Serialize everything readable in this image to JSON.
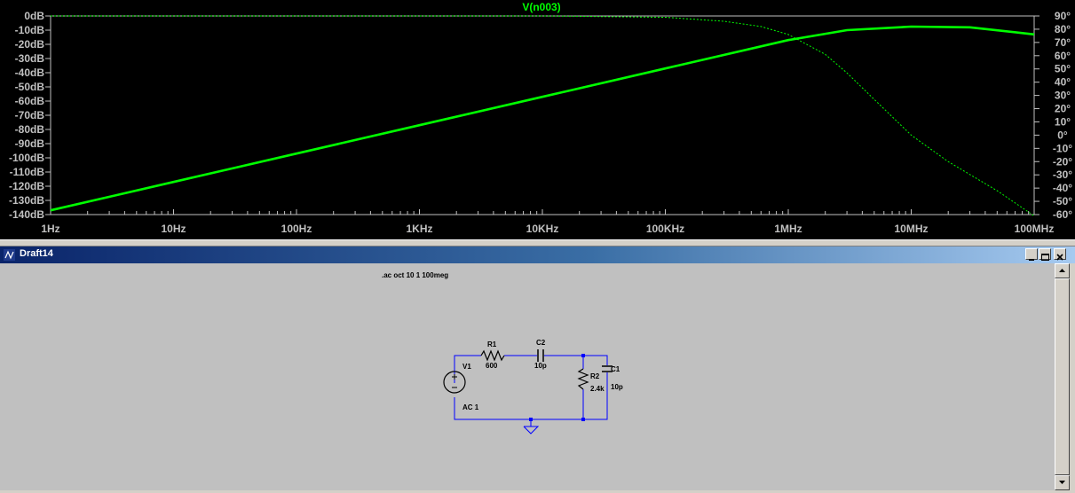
{
  "plot": {
    "trace_label": "V(n003)",
    "trace_color": "#00ff00",
    "background": "#000000",
    "axis_color": "#c0c0c0",
    "chart_data": {
      "type": "line",
      "x_scale": "log",
      "x_range": [
        1,
        100000000
      ],
      "x_ticks": [
        {
          "value": 1,
          "label": "1Hz"
        },
        {
          "value": 10,
          "label": "10Hz"
        },
        {
          "value": 100,
          "label": "100Hz"
        },
        {
          "value": 1000,
          "label": "1KHz"
        },
        {
          "value": 10000,
          "label": "10KHz"
        },
        {
          "value": 100000,
          "label": "100KHz"
        },
        {
          "value": 1000000,
          "label": "1MHz"
        },
        {
          "value": 10000000,
          "label": "10MHz"
        },
        {
          "value": 100000000,
          "label": "100MHz"
        }
      ],
      "y_left_range": [
        -140,
        0
      ],
      "y_left_ticks": [
        "0dB",
        "-10dB",
        "-20dB",
        "-30dB",
        "-40dB",
        "-50dB",
        "-60dB",
        "-70dB",
        "-80dB",
        "-90dB",
        "-100dB",
        "-110dB",
        "-120dB",
        "-130dB",
        "-140dB"
      ],
      "y_right_range": [
        -60,
        90
      ],
      "y_right_ticks": [
        "90°",
        "80°",
        "70°",
        "60°",
        "50°",
        "40°",
        "30°",
        "20°",
        "10°",
        "0°",
        "-10°",
        "-20°",
        "-30°",
        "-40°",
        "-50°",
        "-60°"
      ],
      "series": [
        {
          "name": "V(n003)",
          "quantity": "magnitude",
          "style": "solid",
          "x": [
            1,
            10,
            100,
            1000,
            10000,
            100000,
            1000000,
            3000000,
            10000000,
            30000000,
            100000000
          ],
          "y": [
            -137,
            -117,
            -97,
            -77,
            -57,
            -37,
            -17,
            -10,
            -7.5,
            -8,
            -13
          ]
        },
        {
          "name": "V(n003)",
          "quantity": "phase",
          "style": "dashed",
          "x": [
            1,
            1000,
            10000,
            100000,
            300000,
            600000,
            1000000,
            2000000,
            3000000,
            5000000,
            10000000,
            20000000,
            50000000,
            100000000
          ],
          "y": [
            90,
            90,
            90,
            89,
            86,
            82,
            76,
            61,
            47,
            27,
            0,
            -20,
            -42,
            -61
          ]
        }
      ]
    }
  },
  "window": {
    "title": "Draft14",
    "minimize_glyph": "_",
    "maximize_glyph": "□",
    "close_glyph": "×"
  },
  "schematic": {
    "directive": ".ac oct 10 1 100meg",
    "wire_color": "#0000ff",
    "components": {
      "r1": {
        "name": "R1",
        "value": "600"
      },
      "c2": {
        "name": "C2",
        "value": "10p"
      },
      "r2": {
        "name": "R2",
        "value": "2.4k"
      },
      "c1": {
        "name": "C1",
        "value": "10p"
      },
      "v1": {
        "name": "V1",
        "value": "AC 1"
      }
    }
  }
}
